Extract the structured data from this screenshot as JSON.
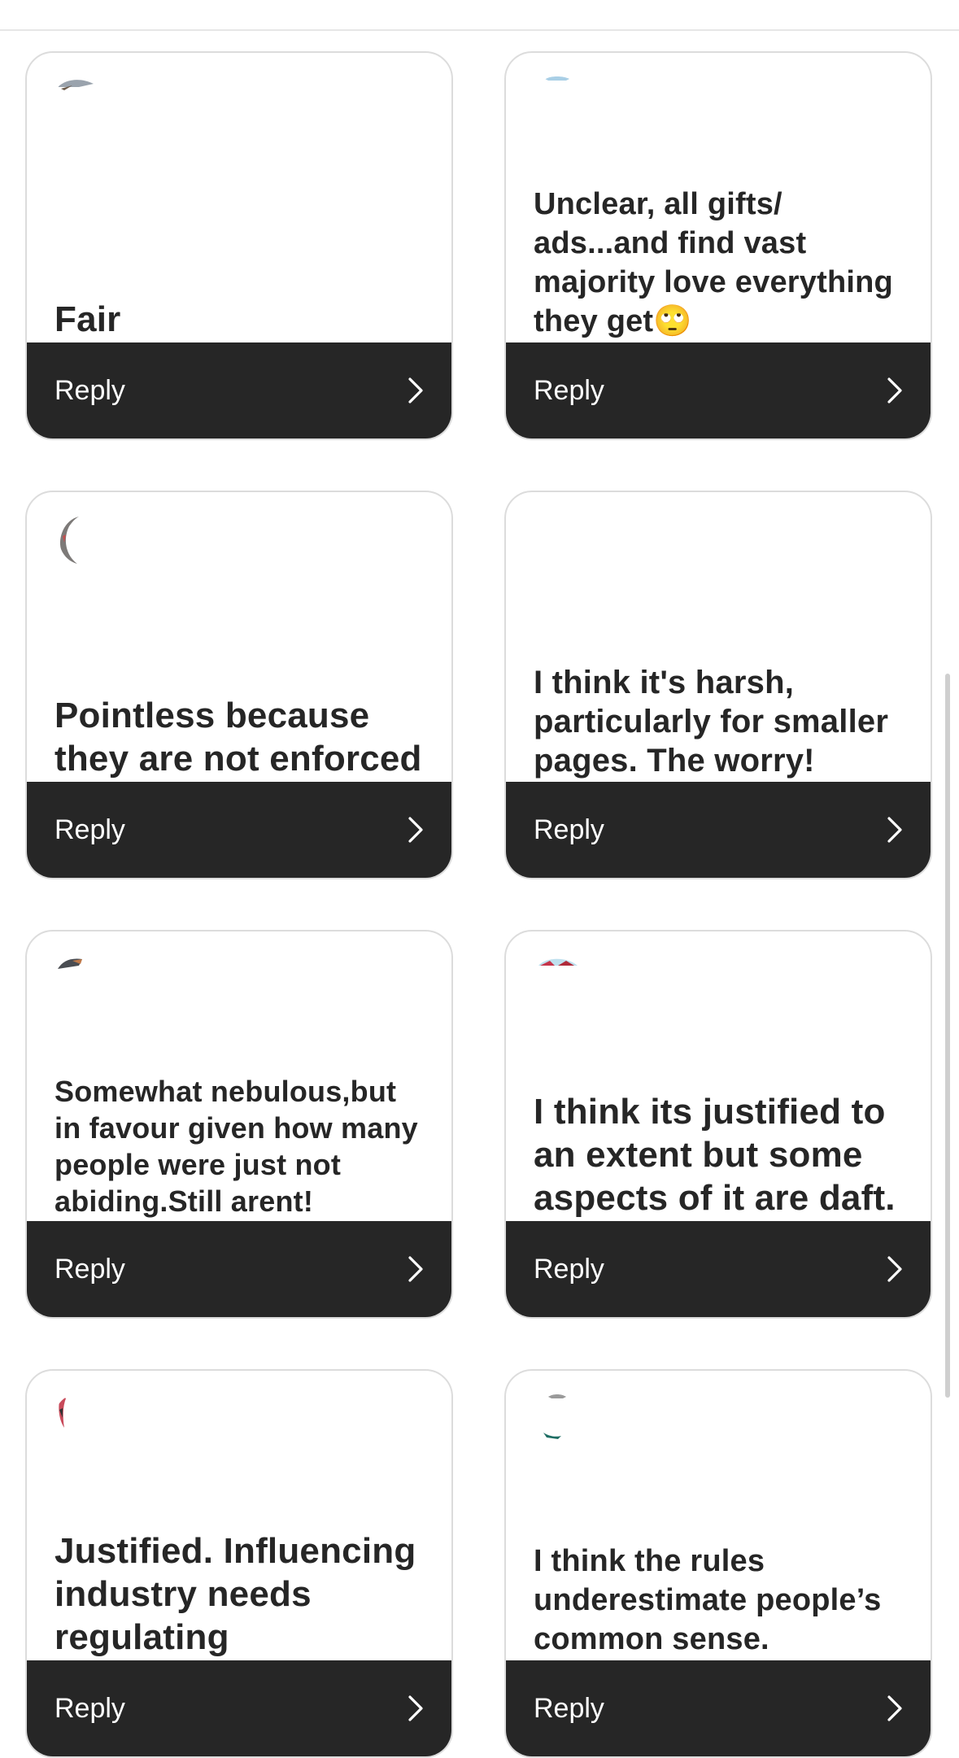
{
  "reply_label": "Reply",
  "colors": {
    "reply_bar": "#262626",
    "card_border": "#dcdcdc",
    "text": "#262626"
  },
  "icons": {
    "reply_arrow": "chevron-right-icon"
  },
  "responses": [
    {
      "id": 1,
      "text": "Fair",
      "column": "left",
      "row": 1
    },
    {
      "id": 2,
      "text": "Unclear,  all gifts/ ads...and find vast majority love everything they get🙄",
      "column": "right",
      "row": 1
    },
    {
      "id": 3,
      "text": "Pointless because they are not enforced",
      "column": "left",
      "row": 2
    },
    {
      "id": 4,
      "text": "I think it's harsh, particularly for smaller pages. The worry!",
      "column": "right",
      "row": 2
    },
    {
      "id": 5,
      "text": "Somewhat nebulous,but in favour given how many people were just not abiding.Still arent!",
      "column": "left",
      "row": 3
    },
    {
      "id": 6,
      "text": "I think its justified to an extent but some aspects of it are daft.",
      "column": "right",
      "row": 3
    },
    {
      "id": 7,
      "text": "Justified. Influencing industry needs regulating",
      "column": "left",
      "row": 4
    },
    {
      "id": 8,
      "text": "I think the rules underestimate people’s common sense.",
      "column": "right",
      "row": 4
    }
  ]
}
